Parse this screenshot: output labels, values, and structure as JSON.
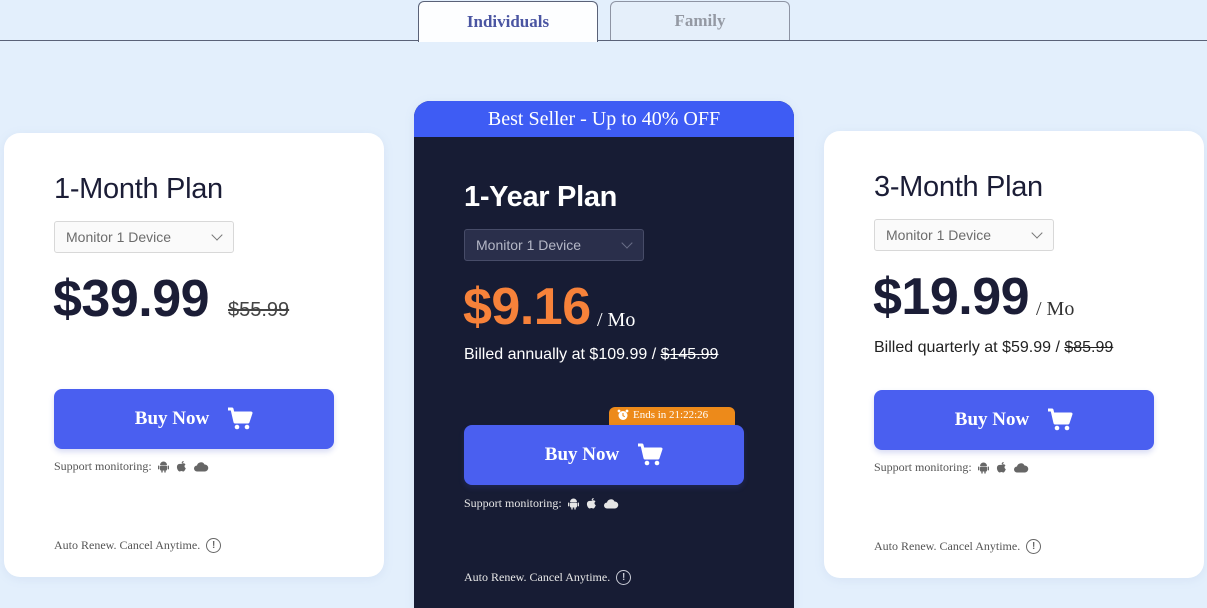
{
  "tabs": [
    {
      "label": "Individuals",
      "active": true
    },
    {
      "label": "Family",
      "active": false
    }
  ],
  "plans": [
    {
      "title": "1-Month Plan",
      "select_value": "Monitor 1 Device",
      "price": "$39.99",
      "old_price": "$55.99",
      "buy_label": "Buy Now",
      "support_label": "Support monitoring:",
      "renew_label": "Auto Renew. Cancel Anytime."
    },
    {
      "banner": "Best Seller - Up to 40% OFF",
      "title": "1-Year Plan",
      "select_value": "Monitor 1 Device",
      "price": "$9.16",
      "per": "/ Mo",
      "billed_prefix": "Billed annually at $109.99 / ",
      "billed_old": "$145.99",
      "timer": "Ends in 21:22:26",
      "buy_label": "Buy Now",
      "support_label": "Support monitoring:",
      "renew_label": "Auto Renew. Cancel Anytime."
    },
    {
      "title": "3-Month Plan",
      "select_value": "Monitor 1 Device",
      "price": "$19.99",
      "per": "/ Mo",
      "billed_prefix": "Billed quarterly at $59.99 / ",
      "billed_old": "$85.99",
      "buy_label": "Buy Now",
      "support_label": "Support monitoring:",
      "renew_label": "Auto Renew. Cancel Anytime."
    }
  ],
  "icons": {
    "platforms": [
      "android-icon",
      "apple-icon",
      "cloud-icon"
    ],
    "cart": "cart-icon",
    "info": "info-icon",
    "clock": "alarm-clock-icon"
  },
  "colors": {
    "accent": "#4a5ff0",
    "banner": "#3e5cf4",
    "featured_bg": "#171c34",
    "featured_price": "#f7823a",
    "timer": "#ed8a1a",
    "page_bg": "#e3effc"
  }
}
